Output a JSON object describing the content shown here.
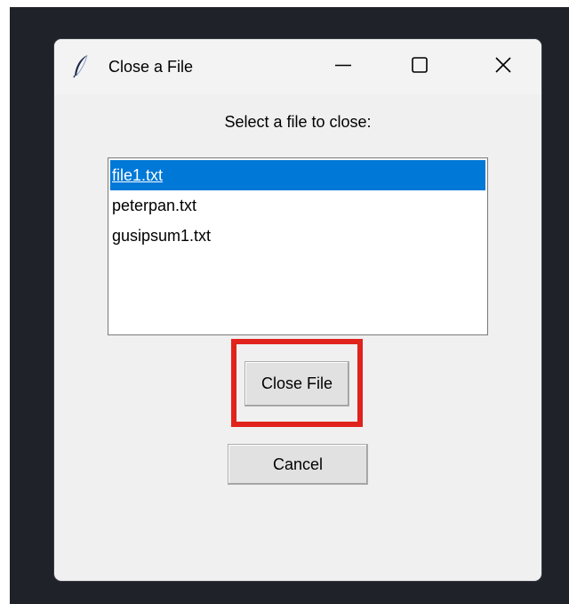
{
  "window": {
    "title": "Close a File",
    "icon": "feather-icon",
    "controls": [
      "minimize-icon",
      "maximize-icon",
      "close-icon"
    ]
  },
  "dialog": {
    "prompt": "Select a file to close:",
    "files": [
      "file1.txt",
      "peterpan.txt",
      "gusipsum1.txt"
    ],
    "selected_file": "file1.txt",
    "close_file_label": "Close File",
    "cancel_label": "Cancel"
  },
  "colors": {
    "selection": "#0078d7",
    "highlight_outline": "#e0231c",
    "window_background": "#f0f0f0",
    "backdrop": "#20222a"
  }
}
